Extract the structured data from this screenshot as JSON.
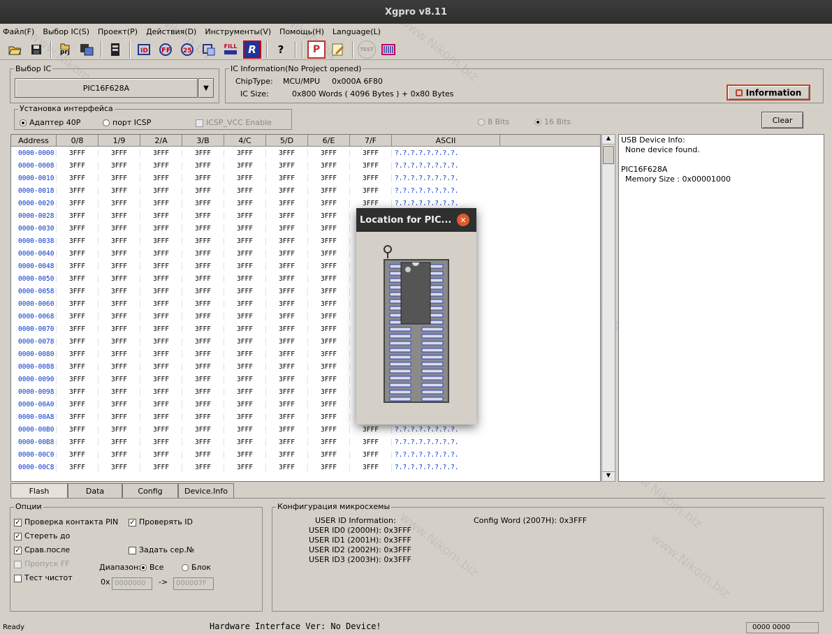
{
  "window": {
    "title": "Xgpro v8.11"
  },
  "menu": [
    "Файл(F)",
    "Выбор IC(S)",
    "Проект(P)",
    "Действия(D)",
    "Инструменты(V)",
    "Помощь(H)",
    "Language(L)"
  ],
  "toolbar": {
    "icons": [
      "open-folder-icon",
      "save-disk-icon",
      "project-icon",
      "save-project-icon",
      "memory-chip-icon",
      "chip-id-icon",
      "read-icon",
      "verify-icon",
      "blank-check-icon",
      "fill-icon",
      "read-r-icon",
      "help-question-icon",
      "protect-p-icon",
      "edit-config-icon",
      "test-icon",
      "adapter-chip-icon"
    ],
    "labels": {
      "fill": "FILL",
      "read_r": "R",
      "help": "?",
      "protect": "P",
      "test": "TEST",
      "prj": "prj"
    }
  },
  "ic_select": {
    "legend": "Выбор IC",
    "value": "PIC16F628A"
  },
  "ic_info": {
    "legend": "IC Information(No Project opened)",
    "chip_type_label": "ChipType:",
    "chip_type_value": "MCU/MPU",
    "chip_id": "0x000A 6F80",
    "ic_size_label": "IC Size:",
    "ic_size_value": "0x800 Words ( 4096 Bytes ) + 0x80 Bytes",
    "information_button": "Information"
  },
  "interface": {
    "legend": "Установка интерфейса",
    "adapter": "Адаптер 40P",
    "icsp": "порт ICSP",
    "icsp_vcc": "ICSP_VCC Enable"
  },
  "bits": {
    "b8": "8 Bits",
    "b16": "16 Bits"
  },
  "clear_button": "Clear",
  "grid": {
    "headers": [
      "Address",
      "0/8",
      "1/9",
      "2/A",
      "3/B",
      "4/C",
      "5/D",
      "6/E",
      "7/F",
      "ASCII"
    ],
    "cell_value": "3FFF",
    "ascii_value": "?.?.?.?.?.?.?.?.",
    "addresses": [
      "0000-0000",
      "0000-0008",
      "0000-0010",
      "0000-0018",
      "0000-0020",
      "0000-0028",
      "0000-0030",
      "0000-0038",
      "0000-0040",
      "0000-0048",
      "0000-0050",
      "0000-0058",
      "0000-0060",
      "0000-0068",
      "0000-0070",
      "0000-0078",
      "0000-0080",
      "0000-0088",
      "0000-0090",
      "0000-0098",
      "0000-00A0",
      "0000-00A8",
      "0000-00B0",
      "0000-00B8",
      "0000-00C0",
      "0000-00C8"
    ]
  },
  "device_info": {
    "line1": "USB Device Info:",
    "line2": "None device found.",
    "line3": "PIC16F628A",
    "line4": "Memory Size : 0x00001000"
  },
  "tabs": [
    "Flash",
    "Data",
    "Config",
    "Device.Info"
  ],
  "options": {
    "legend": "Опции",
    "check_pin": "Проверка контакта PIN",
    "check_id": "Проверять ID",
    "erase_before": "Стереть до",
    "compare_after": "Срав.после",
    "set_serial": "Задать сер.№",
    "skip_ff": "Пропуск FF",
    "test_clean": "Тест чистот",
    "range_label": "Диапазон:",
    "range_all": "Все",
    "range_block": "Блок",
    "hex_prefix": "0x",
    "range_from": "0000000",
    "arrow": "->",
    "range_to": "000007F"
  },
  "config": {
    "legend": "Конфигурация микросхемы",
    "user_id_title": "USER ID Information:",
    "config_word": "Config Word (2007H): 0x3FFF",
    "ids": [
      "USER ID0 (2000H): 0x3FFF",
      "USER ID1 (2001H): 0x3FFF",
      "USER ID2 (2002H): 0x3FFF",
      "USER ID3 (2003H): 0x3FFF"
    ]
  },
  "status": {
    "ready": "Ready",
    "hardware": "Hardware Interface Ver: No Device!",
    "counter": "0000 0000"
  },
  "popup": {
    "title": "Location for  PIC..."
  },
  "watermark": "www.Nikom.biz",
  "colors": {
    "address_blue": "#0033cc",
    "close_orange": "#e05a2a",
    "chip_pin_blue": "#3344aa"
  }
}
